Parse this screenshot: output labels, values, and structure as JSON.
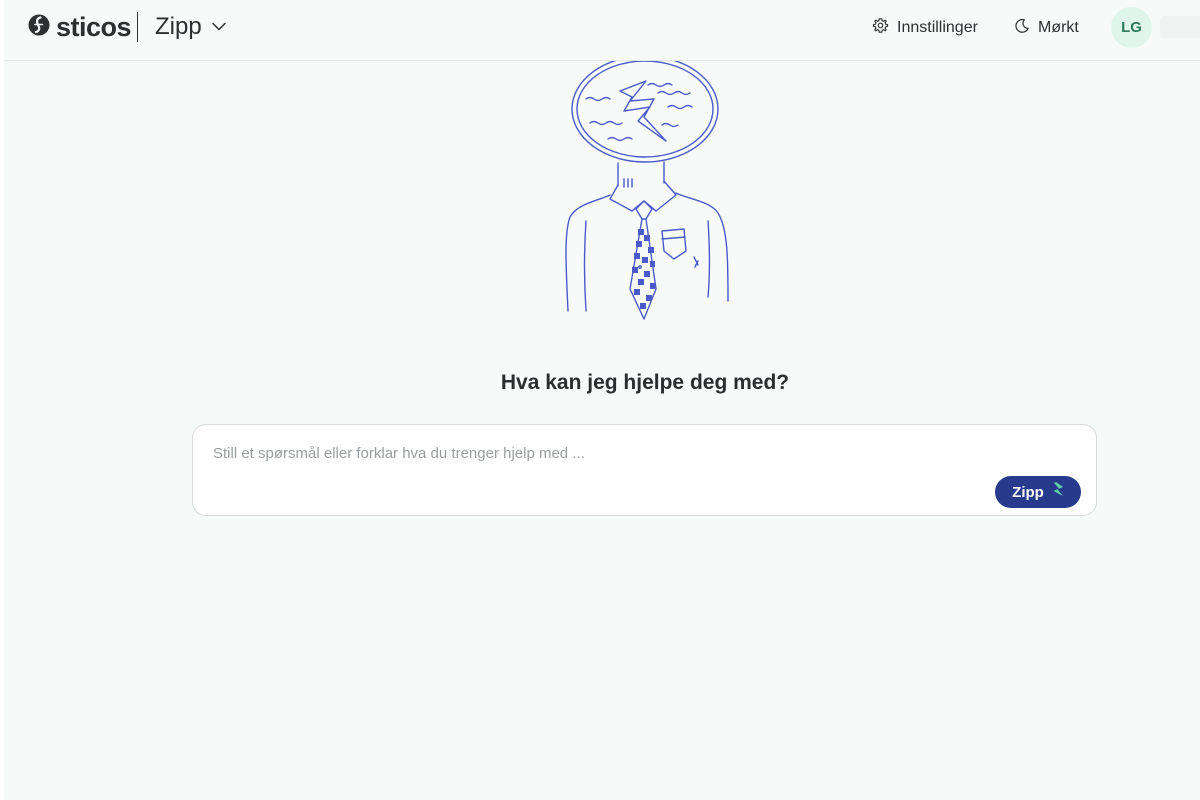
{
  "header": {
    "brand": "sticos",
    "product": "Zipp",
    "settings_label": "Innstillinger",
    "theme_label": "Mørkt",
    "avatar_initials": "LG"
  },
  "main": {
    "headline": "Hva kan jeg hjelpe deg med?",
    "input_placeholder": "Still et spørsmål eller forklar hva du trenger hjelp med ...",
    "input_value": "",
    "submit_label": "Zipp"
  },
  "colors": {
    "background": "#f6faf8",
    "primary": "#283a8c",
    "illustration": "#4a5bc9",
    "accent_green": "#5fd1a7",
    "avatar_bg": "#dff5ec"
  },
  "icons": {
    "brand_logo": "sticos-logo-icon",
    "product_dropdown": "chevron-down-icon",
    "settings": "gear-icon",
    "theme": "moon-icon",
    "submit": "lightning-icon"
  }
}
